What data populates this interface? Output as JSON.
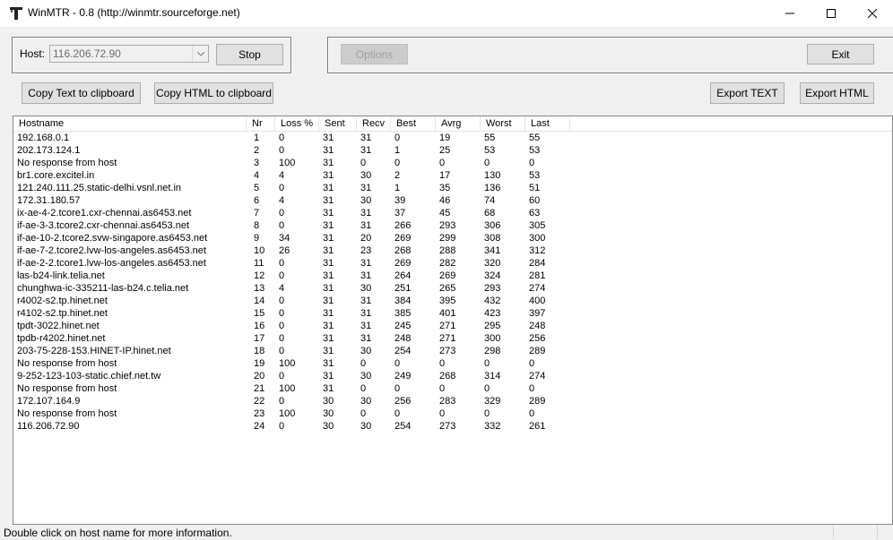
{
  "window": {
    "title": "WinMTR - 0.8 (http://winmtr.sourceforge.net)",
    "app_icon": "winmtr-icon",
    "controls": [
      "minimize-icon",
      "maximize-icon",
      "close-icon"
    ]
  },
  "host": {
    "label": "Host:",
    "value": "116.206.72.90"
  },
  "buttons": {
    "stop": "Stop",
    "options": "Options",
    "exit": "Exit",
    "copy_text": "Copy Text to clipboard",
    "copy_html": "Copy HTML to clipboard",
    "export_text": "Export TEXT",
    "export_html": "Export HTML"
  },
  "table": {
    "columns": [
      "Hostname",
      "Nr",
      "Loss %",
      "Sent",
      "Recv",
      "Best",
      "Avrg",
      "Worst",
      "Last"
    ],
    "rows": [
      [
        "192.168.0.1",
        "1",
        "0",
        "31",
        "31",
        "0",
        "19",
        "55",
        "55"
      ],
      [
        "202.173.124.1",
        "2",
        "0",
        "31",
        "31",
        "1",
        "25",
        "53",
        "53"
      ],
      [
        "No response from host",
        "3",
        "100",
        "31",
        "0",
        "0",
        "0",
        "0",
        "0"
      ],
      [
        "br1.core.excitel.in",
        "4",
        "4",
        "31",
        "30",
        "2",
        "17",
        "130",
        "53"
      ],
      [
        "121.240.111.25.static-delhi.vsnl.net.in",
        "5",
        "0",
        "31",
        "31",
        "1",
        "35",
        "136",
        "51"
      ],
      [
        "172.31.180.57",
        "6",
        "4",
        "31",
        "30",
        "39",
        "46",
        "74",
        "60"
      ],
      [
        "ix-ae-4-2.tcore1.cxr-chennai.as6453.net",
        "7",
        "0",
        "31",
        "31",
        "37",
        "45",
        "68",
        "63"
      ],
      [
        "if-ae-3-3.tcore2.cxr-chennai.as6453.net",
        "8",
        "0",
        "31",
        "31",
        "266",
        "293",
        "306",
        "305"
      ],
      [
        "if-ae-10-2.tcore2.svw-singapore.as6453.net",
        "9",
        "34",
        "31",
        "20",
        "269",
        "299",
        "308",
        "300"
      ],
      [
        "if-ae-7-2.tcore2.lvw-los-angeles.as6453.net",
        "10",
        "26",
        "31",
        "23",
        "268",
        "288",
        "341",
        "312"
      ],
      [
        "if-ae-2-2.tcore1.lvw-los-angeles.as6453.net",
        "11",
        "0",
        "31",
        "31",
        "269",
        "282",
        "320",
        "284"
      ],
      [
        "las-b24-link.telia.net",
        "12",
        "0",
        "31",
        "31",
        "264",
        "269",
        "324",
        "281"
      ],
      [
        "chunghwa-ic-335211-las-b24.c.telia.net",
        "13",
        "4",
        "31",
        "30",
        "251",
        "265",
        "293",
        "274"
      ],
      [
        "r4002-s2.tp.hinet.net",
        "14",
        "0",
        "31",
        "31",
        "384",
        "395",
        "432",
        "400"
      ],
      [
        "r4102-s2.tp.hinet.net",
        "15",
        "0",
        "31",
        "31",
        "385",
        "401",
        "423",
        "397"
      ],
      [
        "tpdt-3022.hinet.net",
        "16",
        "0",
        "31",
        "31",
        "245",
        "271",
        "295",
        "248"
      ],
      [
        "tpdb-r4202.hinet.net",
        "17",
        "0",
        "31",
        "31",
        "248",
        "271",
        "300",
        "256"
      ],
      [
        "203-75-228-153.HINET-IP.hinet.net",
        "18",
        "0",
        "31",
        "30",
        "254",
        "273",
        "298",
        "289"
      ],
      [
        "No response from host",
        "19",
        "100",
        "31",
        "0",
        "0",
        "0",
        "0",
        "0"
      ],
      [
        "9-252-123-103-static.chief.net.tw",
        "20",
        "0",
        "31",
        "30",
        "249",
        "268",
        "314",
        "274"
      ],
      [
        "No response from host",
        "21",
        "100",
        "31",
        "0",
        "0",
        "0",
        "0",
        "0"
      ],
      [
        "172.107.164.9",
        "22",
        "0",
        "30",
        "30",
        "256",
        "283",
        "329",
        "289"
      ],
      [
        "No response from host",
        "23",
        "100",
        "30",
        "0",
        "0",
        "0",
        "0",
        "0"
      ],
      [
        "116.206.72.90",
        "24",
        "0",
        "30",
        "30",
        "254",
        "273",
        "332",
        "261"
      ]
    ]
  },
  "status": {
    "text": "Double click on host name for more information."
  }
}
